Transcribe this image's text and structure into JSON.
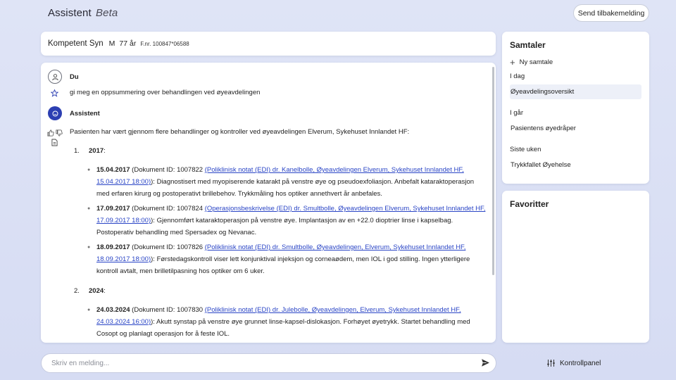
{
  "header": {
    "app_name": "Assistent",
    "beta_tag": "Beta",
    "feedback_button": "Send tilbakemelding"
  },
  "patient": {
    "name": "Kompetent Syn",
    "sex": "M",
    "age": "77 år",
    "fnr": "F.nr. 100847*06588"
  },
  "chat": {
    "user_label": "Du",
    "user_message": "gi meg en oppsummering over behandlingen ved øyeavdelingen",
    "bot_label": "Assistent",
    "intro": "Pasienten har vært gjennom flere behandlinger og kontroller ved øyeavdelingen Elverum, Sykehuset Innlandet HF:",
    "years": [
      {
        "num": "1.",
        "year": "2017",
        "suffix": ":",
        "entries": [
          {
            "date": "15.04.2017",
            "doc_prefix": " (Dokument ID: 1007822 ",
            "link": "(Poliklinisk notat (EDI) dr. Kanelbolle, Øyeavdelingen Elverum, Sykehuset Innlandet HF, 15.04.2017 18:00)",
            "text": "): Diagnostisert med myopiserende katarakt på venstre øye og pseudoexfoliasjon. Anbefalt kataraktoperasjon med erfaren kirurg og postoperativt brillebehov. Trykkmåling hos optiker annethvert år anbefales."
          },
          {
            "date": "17.09.2017",
            "doc_prefix": " (Dokument ID: 1007824 ",
            "link": "(Operasjonsbeskrivelse (EDI) dr. Smultbolle, Øyeavdelingen Elverum, Sykehuset Innlandet HF, 17.09.2017 18:00)",
            "text": "): Gjennomført kataraktoperasjon på venstre øye. Implantasjon av en +22.0 dioptrier linse i kapselbag. Postoperativ behandling med Spersadex og Nevanac."
          },
          {
            "date": "18.09.2017",
            "doc_prefix": " (Dokument ID: 1007826 ",
            "link": "(Poliklinisk notat (EDI) dr. Smultbolle, Øyeavdelingen, Elverum, Sykehuset Innlandet HF, 18.09.2017 18:00)",
            "text": "): Førstedagskontroll viser lett konjunktival injeksjon og corneaødem, men IOL i god stilling. Ingen ytterligere kontroll avtalt, men brilletilpasning hos optiker om 6 uker."
          }
        ]
      },
      {
        "num": "2.",
        "year": "2024",
        "suffix": ":",
        "entries": [
          {
            "date": "24.03.2024",
            "doc_prefix": " (Dokument ID: 1007830 ",
            "link": "(Poliklinisk notat (EDI) dr. Julebolle, Øyeavdelingen, Elverum, Sykehuset Innlandet HF, 24.03.2024 16:00)",
            "text": "): Akutt synstap på venstre øye grunnet linse-kapsel-dislokasjon. Forhøyet øyetrykk. Startet behandling med Cosopt og planlagt operasjon for å feste IOL."
          }
        ]
      }
    ]
  },
  "input": {
    "placeholder": "Skriv en melding..."
  },
  "sidebar": {
    "heading": "Samtaler",
    "new_chat": "Ny samtale",
    "groups": [
      {
        "label": "I dag",
        "items": [
          "Øyeavdelingsoversikt"
        ]
      },
      {
        "label": "I går",
        "items": [
          "Pasientens øyedråper"
        ]
      },
      {
        "label": "Siste uken",
        "items": [
          "Trykkfallet Øyehelse"
        ]
      }
    ],
    "favorites_heading": "Favoritter"
  },
  "footer": {
    "control_panel": "Kontrollpanel"
  },
  "colors": {
    "accent": "#2c3fb2",
    "link": "#2a45c6",
    "background": "#dfe4f6"
  }
}
